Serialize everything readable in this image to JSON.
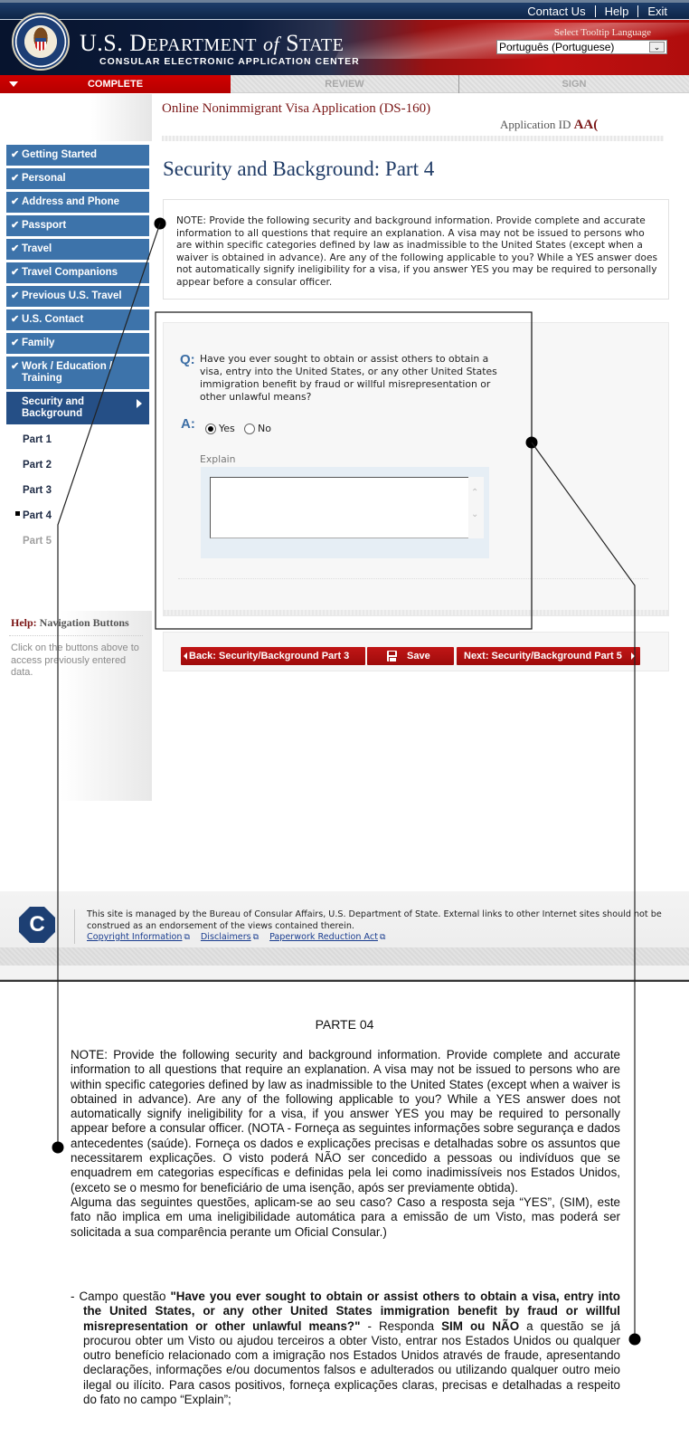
{
  "header": {
    "top_links": [
      "Contact Us",
      "Help",
      "Exit"
    ],
    "dept_title_us": "U.S. D",
    "dept_title_partment": "EPARTMENT",
    "dept_title_of": "of",
    "dept_title_s": "S",
    "dept_title_tate": "TATE",
    "subtitle": "CONSULAR ELECTRONIC APPLICATION CENTER",
    "tooltip_language_label": "Select Tooltip Language",
    "tooltip_language_value": "Português (Portuguese)"
  },
  "progress_tabs": [
    {
      "label": "COMPLETE",
      "state": "active"
    },
    {
      "label": "REVIEW",
      "state": "inactive"
    },
    {
      "label": "SIGN",
      "state": "inactive"
    }
  ],
  "main": {
    "app_title": "Online Nonimmigrant Visa Application (DS-160)",
    "app_id_label": "Application ID",
    "app_id_value": "AA(",
    "page_title": "Security and Background: Part 4",
    "note": "NOTE: Provide the following security and background information. Provide complete and accurate information to all questions that require an explanation. A visa may not be issued to persons who are within specific categories defined by law as inadmissible to the United States (except when a waiver is obtained in advance). Are any of the following applicable to you? While a YES answer does not automatically signify ineligibility for a visa, if you answer YES you may be required to personally appear before a consular officer.",
    "question": {
      "q_label": "Q:",
      "text": "Have you ever sought to obtain or assist others to obtain a visa, entry into the United States, or any other United States immigration benefit by fraud or willful misrepresentation or other unlawful means?",
      "a_label": "A:",
      "options": [
        "Yes",
        "No"
      ],
      "selected": "Yes",
      "explain_label": "Explain",
      "explain_value": ""
    },
    "buttons": {
      "back": "Back: Security/Background Part 3",
      "save": "Save",
      "next": "Next: Security/Background Part 5"
    }
  },
  "sidebar": {
    "items": [
      {
        "label": "Getting Started",
        "completed": true
      },
      {
        "label": "Personal",
        "completed": true
      },
      {
        "label": "Address and Phone",
        "completed": true
      },
      {
        "label": "Passport",
        "completed": true
      },
      {
        "label": "Travel",
        "completed": true
      },
      {
        "label": "Travel Companions",
        "completed": true
      },
      {
        "label": "Previous U.S. Travel",
        "completed": true
      },
      {
        "label": "U.S. Contact",
        "completed": true
      },
      {
        "label": "Family",
        "completed": true
      },
      {
        "label": "Work / Education / Training",
        "completed": true
      },
      {
        "label": "Security and Background",
        "current": true
      }
    ],
    "sub_items": [
      {
        "label": "Part 1"
      },
      {
        "label": "Part 2"
      },
      {
        "label": "Part 3"
      },
      {
        "label": "Part 4",
        "current": true
      },
      {
        "label": "Part 5",
        "disabled": true
      }
    ],
    "help": {
      "title_prefix": "Help:",
      "title": "Navigation Buttons",
      "text": "Click on the buttons above to access previously entered data."
    }
  },
  "footer": {
    "logo_letter": "C",
    "text": "This site is managed by the Bureau of Consular Affairs, U.S. Department of State. External links to other Internet sites should not be construed as an endorsement of the views contained therein.",
    "links": [
      "Copyright Information",
      "Disclaimers",
      "Paperwork Reduction Act"
    ]
  },
  "annotation_doc": {
    "title": "PARTE 04",
    "paragraph1": "NOTE: Provide the following security and background information. Provide complete and accurate information to all questions that require an explanation. A visa may not be issued to persons who are within specific categories defined by law as inadmissible to the United States (except when a waiver is obtained in advance). Are any of the following applicable to you? While a YES answer does not automatically signify ineligibility for a visa, if you answer YES you may be required to personally appear before a consular officer. (NOTA - Forneça as seguintes informações sobre segurança e dados antecedentes (saúde). Forneça os dados e explicações precisas e detalhadas sobre os assuntos que necessitarem explicações. O visto poderá NÃO ser concedido a pessoas ou indivíduos que se enquadrem em categorias específicas e definidas pela lei como inadimissíveis nos Estados Unidos, (exceto se o mesmo for beneficiário de uma isenção, após ser previamente obtida).",
    "paragraph2": "Alguma das seguintes questões, aplicam-se ao seu caso? Caso a resposta seja “YES”, (SIM), este fato não implica em uma ineligibilidade automática para a emissão de um Visto, mas poderá ser solicitada a sua comparência perante um Oficial Consular.)",
    "item_prefix": "- Campo questão ",
    "item_question": "\"Have you ever sought to obtain or assist others to obtain a visa, entry into the United States, or any other United States immigration benefit by fraud or willful misrepresentation or other unlawful means?\"",
    "item_mid": " - Responda ",
    "item_sim_nao": "SIM ou NÃO",
    "item_rest": " a questão se já procurou obter um Visto ou ajudou terceiros a obter Visto, entrar nos Estados Unidos ou qualquer outro benefício relacionado com a imigração nos Estados Unidos através de fraude, apresentando declarações, informações e/ou documentos falsos e adulterados ou utilizando qualquer outro meio ilegal ou ilícito. Para casos positivos, forneça explicações claras, precisas e detalhadas a respeito do fato no campo “Explain”;"
  }
}
